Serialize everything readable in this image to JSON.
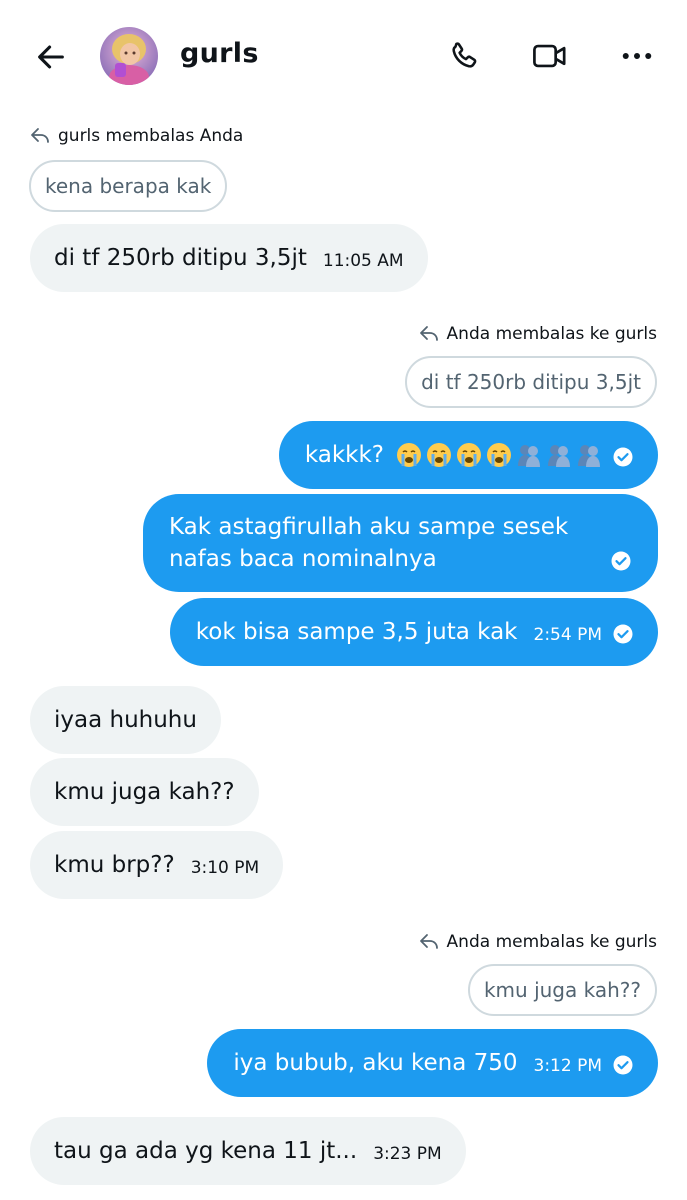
{
  "header": {
    "chat_name": "gurls"
  },
  "messages": [
    {
      "reply_label": "gurls membalas Anda",
      "quote": "kena berapa kak"
    },
    {
      "text": "di tf 250rb ditipu 3,5jt",
      "time": "11:05 AM"
    },
    {
      "reply_label": "Anda membalas ke gurls",
      "quote": "di tf 250rb ditipu 3,5jt"
    },
    {
      "text": "kakkk?",
      "emojis": [
        "loudly-crying-face",
        "loudly-crying-face",
        "loudly-crying-face",
        "loudly-crying-face",
        "people-hugging",
        "people-hugging",
        "people-hugging"
      ]
    },
    {
      "line1": "Kak astagfirullah aku sampe sesek",
      "line2": "nafas baca nominalnya"
    },
    {
      "text": "kok bisa sampe 3,5 juta kak",
      "time": "2:54 PM"
    },
    {
      "text": "iyaa huhuhu"
    },
    {
      "text": "kmu juga kah??"
    },
    {
      "text": "kmu brp??",
      "time": "3:10 PM"
    },
    {
      "reply_label": "Anda membalas ke gurls",
      "quote": "kmu juga kah??"
    },
    {
      "text": "iya bubub, aku kena 750",
      "time": "3:12 PM"
    },
    {
      "text": "tau ga ada yg kena 11 jt...",
      "time": "3:23 PM"
    }
  ],
  "colors": {
    "accent": "#1d9bf0",
    "incoming_bubble": "#eff3f4",
    "muted_text": "#536471",
    "border": "#cfd9de"
  },
  "icons": [
    "back-arrow-icon",
    "phone-icon",
    "video-camera-icon",
    "more-options-icon",
    "reply-arrow-icon",
    "read-check-icon"
  ]
}
